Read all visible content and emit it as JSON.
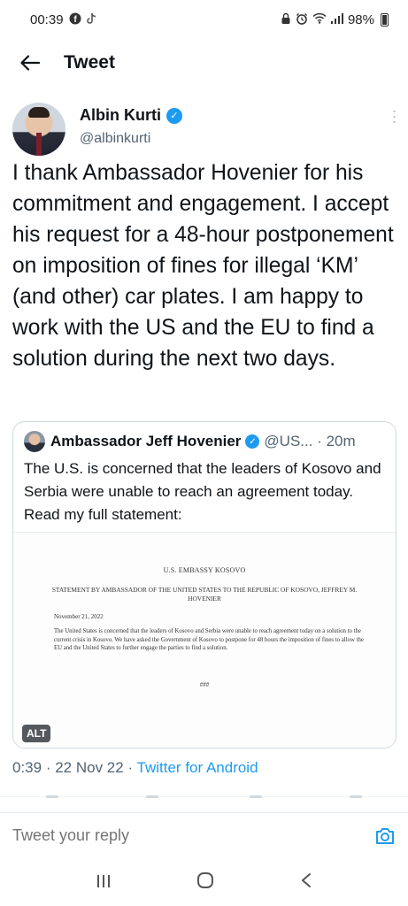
{
  "status_bar": {
    "time": "00:39",
    "battery": "98%",
    "left_icons": [
      "facebook-icon",
      "tiktok-icon"
    ],
    "right_icons": [
      "lock-icon",
      "alarm-icon",
      "wifi-icon",
      "signal-icon",
      "battery-icon"
    ]
  },
  "topbar": {
    "back_icon": "arrow-left-icon",
    "title": "Tweet"
  },
  "tweet": {
    "author_name": "Albin Kurti",
    "author_handle": "@albinkurti",
    "text": "I thank Ambassador Hovenier for his commitment and engagement. I accept his request for a 48-hour postponement on imposition of fines for illegal ‘KM’ (and other) car plates. I am happy to work with the US and the EU to find a solution during the next two days.",
    "meta_time": "0:39",
    "meta_date": "22 Nov 22",
    "meta_source": "Twitter for Android"
  },
  "quote": {
    "author_name": "Ambassador Jeff Hovenier",
    "author_handle": "@US...",
    "time_ago": "20m",
    "text": "The U.S. is concerned that the leaders of Kosovo and Serbia were unable to reach an agreement today. Read my full statement:",
    "alt_badge": "ALT",
    "document": {
      "header": "U.S. EMBASSY KOSOVO",
      "title": "STATEMENT BY AMBASSADOR OF THE UNITED STATES TO THE REPUBLIC OF KOSOVO, JEFFREY M. HOVENIER",
      "date": "November 21, 2022",
      "body": "The United States is concerned that the leaders of Kosovo and Serbia were unable to reach agreement today on a solution to the current crisis in Kosovo. We have asked the Government of Kosovo to postpone for 48 hours the imposition of fines to allow the EU and the United States to further engage the parties to find a solution.",
      "end": "###"
    }
  },
  "reply": {
    "placeholder": "Tweet your reply",
    "camera_icon": "camera-icon"
  },
  "nav_bar": {
    "recents_icon": "recents-icon",
    "home_icon": "home-icon",
    "back_icon": "nav-back-icon"
  },
  "colors": {
    "accent": "#1d9bf0",
    "text": "#0f1419",
    "secondary_text": "#536471",
    "border": "#cfd9de"
  }
}
